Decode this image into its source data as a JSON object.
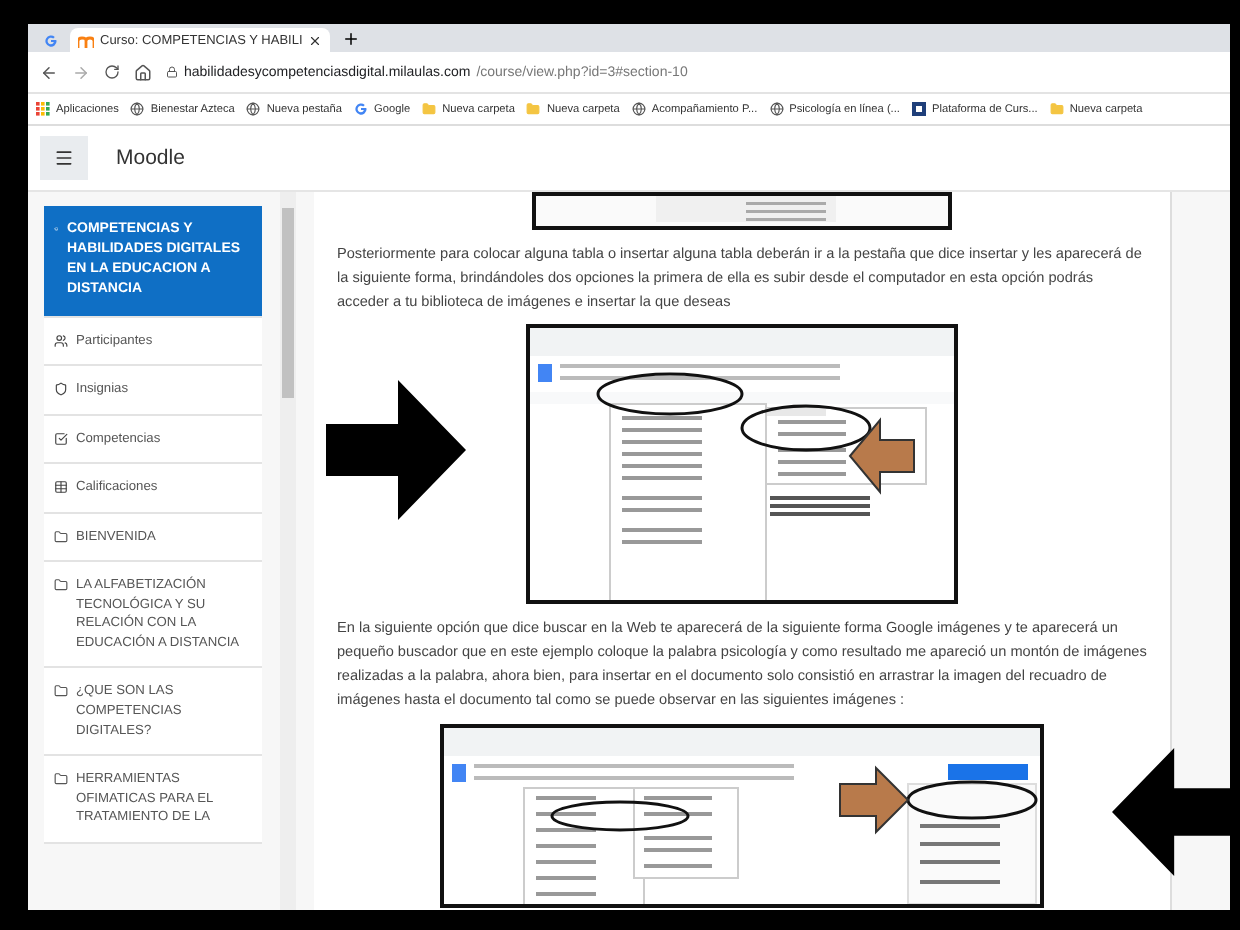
{
  "browser": {
    "tabs": [
      {
        "kind": "google",
        "selected": false
      },
      {
        "kind": "moodle",
        "title": "Curso: COMPETENCIAS Y HABILI",
        "selected": true
      }
    ],
    "url_host": "habilidadesycompetenciasdigital.milaulas.com",
    "url_path": "/course/view.php?id=3#section-10",
    "bookmarks": [
      {
        "kind": "apps",
        "label": "Aplicaciones"
      },
      {
        "kind": "globe",
        "label": "Bienestar Azteca"
      },
      {
        "kind": "globe",
        "label": "Nueva pestaña"
      },
      {
        "kind": "google",
        "label": "Google"
      },
      {
        "kind": "folder",
        "label": "Nueva carpeta"
      },
      {
        "kind": "folder",
        "label": "Nueva carpeta"
      },
      {
        "kind": "globe",
        "label": "Acompañamiento P..."
      },
      {
        "kind": "globe",
        "label": "Psicología en línea (..."
      },
      {
        "kind": "platform",
        "label": "Plataforma de Curs..."
      },
      {
        "kind": "folder",
        "label": "Nueva carpeta"
      }
    ]
  },
  "header": {
    "title": "Moodle"
  },
  "sidebar": {
    "items": [
      {
        "kind": "course",
        "label": "COMPETENCIAS Y HABILIDADES DIGITALES EN LA EDUCACION A DISTANCIA",
        "selected": true
      },
      {
        "kind": "participants",
        "label": "Participantes",
        "selected": false
      },
      {
        "kind": "badges",
        "label": "Insignias",
        "selected": false
      },
      {
        "kind": "competencies",
        "label": "Competencias",
        "selected": false
      },
      {
        "kind": "grades",
        "label": "Calificaciones",
        "selected": false
      },
      {
        "kind": "section",
        "label": "BIENVENIDA",
        "selected": false
      },
      {
        "kind": "section",
        "label": "LA ALFABETIZACIÓN TECNOLÓGICA Y SU RELACIÓN CON LA EDUCACIÓN A DISTANCIA",
        "selected": false
      },
      {
        "kind": "section",
        "label": "¿QUE SON LAS COMPETENCIAS DIGITALES?",
        "selected": false
      },
      {
        "kind": "section",
        "label": "HERRAMIENTAS OFIMATICAS PARA EL TRATAMIENTO DE LA",
        "selected": false
      }
    ]
  },
  "content": [
    {
      "kind": "image"
    },
    {
      "kind": "paragraph",
      "text": "Posteriormente para colocar alguna tabla o insertar alguna tabla deberán ir a la pestaña que dice insertar y les aparecerá de la siguiente forma, brindándoles dos opciones la primera de ella es subir desde el computador en esta opción podrás acceder a tu biblioteca de imágenes e insertar la que deseas"
    },
    {
      "kind": "image"
    },
    {
      "kind": "paragraph",
      "text": "En la siguiente opción que dice buscar en la Web te aparecerá de la siguiente forma Google imágenes y te aparecerá un pequeño buscador que en este ejemplo coloque la palabra psicología y como resultado me apareció un montón de imágenes realizadas a la palabra, ahora bien, para insertar en el documento solo consistió en arrastrar  la imagen del recuadro de imágenes  hasta  el documento  tal como se puede  observar en las  siguientes  imágenes :"
    },
    {
      "kind": "image"
    }
  ]
}
